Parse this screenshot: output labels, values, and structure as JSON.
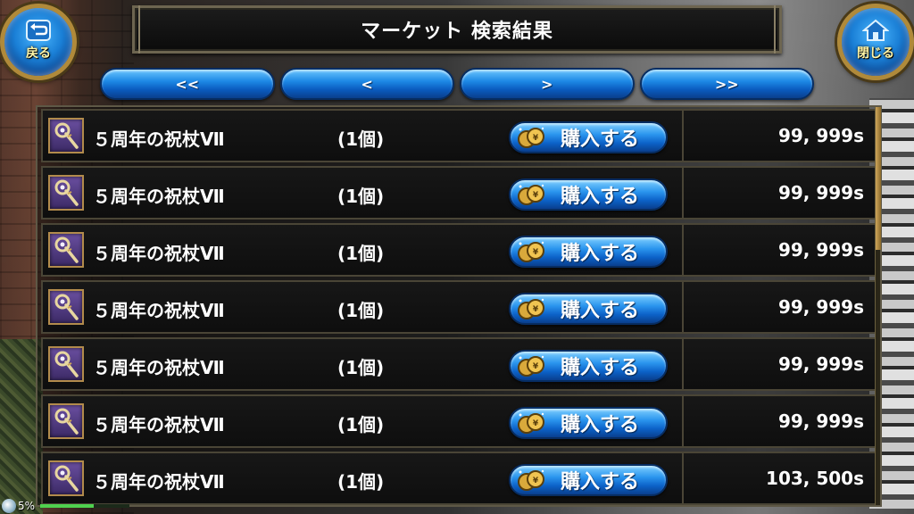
{
  "header": {
    "title": "マーケット 検索結果",
    "back_label": "戻る",
    "close_label": "閉じる"
  },
  "pager": {
    "first": "<<",
    "prev": "<",
    "next": ">",
    "last": ">>"
  },
  "buy_label": "購入する",
  "items": [
    {
      "name": "５周年の祝杖Ⅶ",
      "qty": "(1個)",
      "price": "99, 999s"
    },
    {
      "name": "５周年の祝杖Ⅶ",
      "qty": "(1個)",
      "price": "99, 999s"
    },
    {
      "name": "５周年の祝杖Ⅶ",
      "qty": "(1個)",
      "price": "99, 999s"
    },
    {
      "name": "５周年の祝杖Ⅶ",
      "qty": "(1個)",
      "price": "99, 999s"
    },
    {
      "name": "５周年の祝杖Ⅶ",
      "qty": "(1個)",
      "price": "99, 999s"
    },
    {
      "name": "５周年の祝杖Ⅶ",
      "qty": "(1個)",
      "price": "99, 999s"
    },
    {
      "name": "５周年の祝杖Ⅶ",
      "qty": "(1個)",
      "price": "103, 500s"
    }
  ],
  "status": {
    "battery": "5%",
    "progress": 0.6
  },
  "colors": {
    "accent_blue": "#1e8ae6",
    "gold_frame": "#b08a3a",
    "label_yellow": "#fff6a8"
  },
  "icons": {
    "back": "return-arrow-icon",
    "close": "home-icon",
    "item": "staff-icon",
    "buy": "coin-icon"
  }
}
